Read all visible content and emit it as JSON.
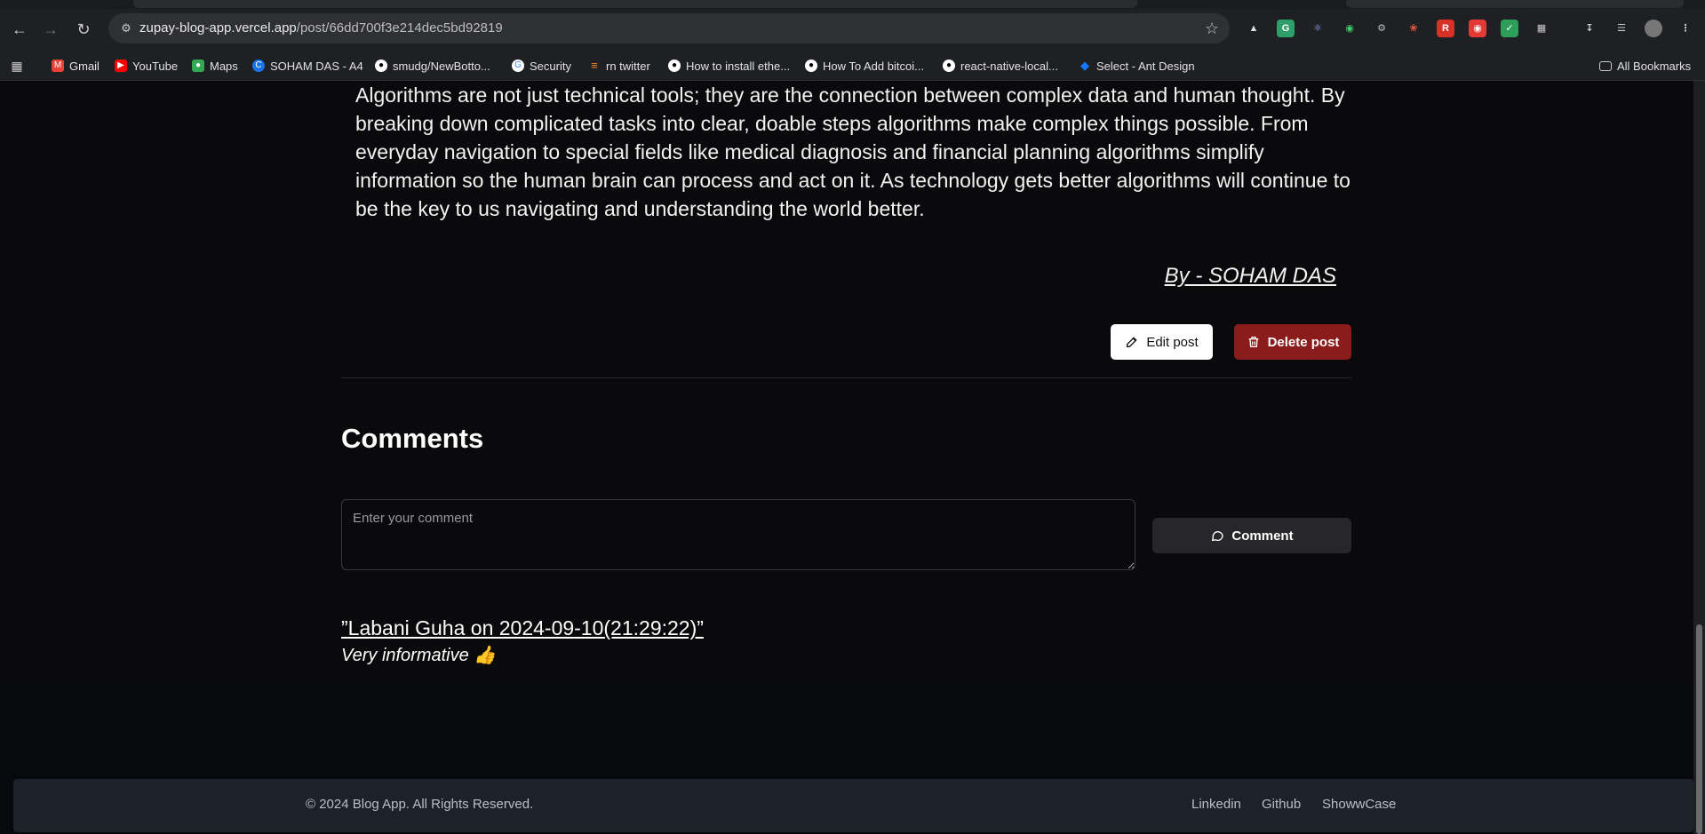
{
  "browser": {
    "url_host": "zupay-blog-app.vercel.app",
    "url_path": "/post/66dd700f3e214dec5bd92819",
    "bookmarks": [
      {
        "label": "Gmail",
        "icon": "gmail-icon",
        "color": "#ea4335"
      },
      {
        "label": "YouTube",
        "icon": "youtube-icon",
        "color": "#ff0000"
      },
      {
        "label": "Maps",
        "icon": "maps-icon",
        "color": "#34a853"
      },
      {
        "label": "SOHAM DAS - A4",
        "icon": "site-icon",
        "color": "#1a73e8"
      },
      {
        "label": "smudg/NewBotto...",
        "icon": "github-icon",
        "color": "#ffffff"
      },
      {
        "label": "Security",
        "icon": "google-icon",
        "color": "#4285f4"
      },
      {
        "label": "rn twitter",
        "icon": "stack-icon",
        "color": "#f48024"
      },
      {
        "label": "How to install ethe...",
        "icon": "github-icon",
        "color": "#ffffff"
      },
      {
        "label": "How To Add bitcoi...",
        "icon": "github-icon",
        "color": "#ffffff"
      },
      {
        "label": "react-native-local...",
        "icon": "github-icon",
        "color": "#ffffff"
      },
      {
        "label": "Select - Ant Design",
        "icon": "antd-icon",
        "color": "#1677ff"
      }
    ],
    "all_bookmarks_label": "All Bookmarks"
  },
  "article": {
    "paragraph": "Algorithms are not just technical tools; they are the connection between complex data and human thought. By breaking down complicated tasks into clear, doable steps algorithms make complex things possible. From everyday navigation to special fields like medical diagnosis and financial planning algorithms simplify information so the human brain can process and act on it. As technology gets better algorithms will continue to be the key to us navigating and understanding the world better.",
    "byline": "By - SOHAM DAS",
    "edit_label": "Edit post",
    "delete_label": "Delete post"
  },
  "comments": {
    "title": "Comments",
    "input_placeholder": "Enter your comment",
    "submit_label": "Comment",
    "items": [
      {
        "author_line": "”Labani Guha on 2024-09-10(21:29:22)”",
        "text": "Very informative 👍"
      }
    ]
  },
  "footer": {
    "copyright": "© 2024 Blog App. All Rights Reserved.",
    "links": [
      "Linkedin",
      "Github",
      "ShowwCase"
    ]
  },
  "colors": {
    "page_bg": "#0a0a0c",
    "delete_button": "#8b1c1c",
    "comment_button": "#27272a",
    "footer_bg": "#1c212a"
  }
}
